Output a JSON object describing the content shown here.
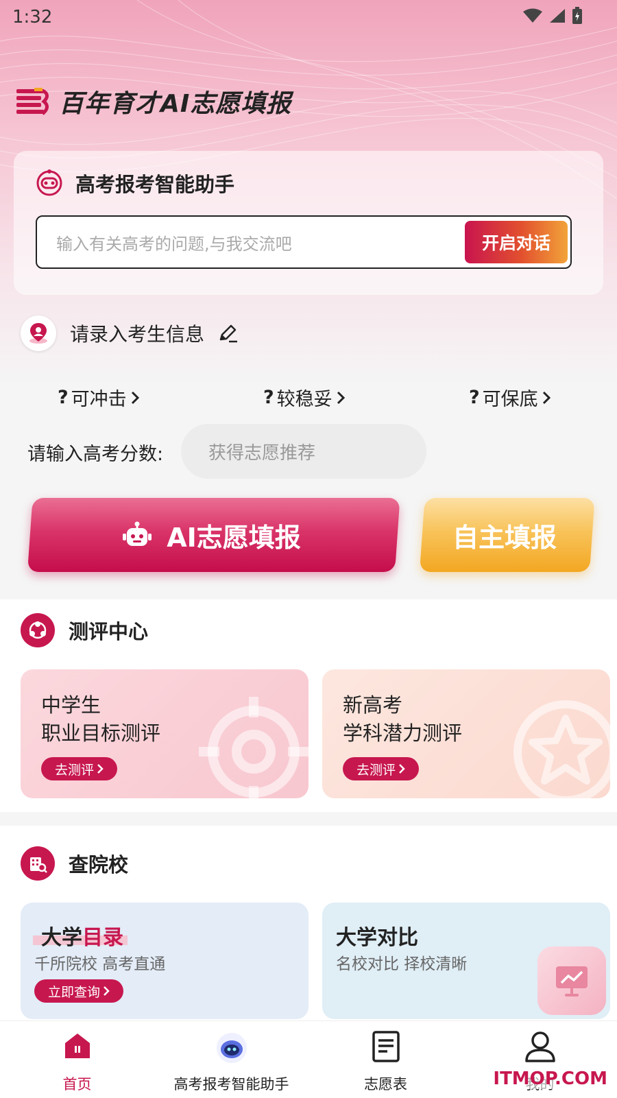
{
  "status": {
    "time": "1:32"
  },
  "app": {
    "title": "百年育才AI志愿填报"
  },
  "assistant": {
    "title": "高考报考智能助手",
    "input_placeholder": "输入有关高考的问题,与我交流吧",
    "button": "开启对话"
  },
  "student": {
    "prompt": "请录入考生信息"
  },
  "levels": [
    {
      "count": "?",
      "label": "可冲击"
    },
    {
      "count": "?",
      "label": "较稳妥"
    },
    {
      "count": "?",
      "label": "可保底"
    }
  ],
  "score": {
    "label": "请输入高考分数:",
    "placeholder": "获得志愿推荐"
  },
  "actions": {
    "ai": "AI志愿填报",
    "self": "自主填报"
  },
  "evaluation": {
    "title": "测评中心",
    "cards": [
      {
        "line1": "中学生",
        "line2": "职业目标测评",
        "button": "去测评"
      },
      {
        "line1": "新高考",
        "line2": "学科潜力测评",
        "button": "去测评"
      }
    ]
  },
  "colleges": {
    "title": "查院校",
    "cards": [
      {
        "title_a": "大学",
        "title_b": "目录",
        "subtitle": "千所院校 高考直通",
        "button": "立即查询"
      },
      {
        "title": "大学对比",
        "subtitle": "名校对比 择校清晰"
      }
    ]
  },
  "tabs": [
    {
      "label": "首页",
      "icon": "home-icon"
    },
    {
      "label": "高考报考智能助手",
      "icon": "robot-icon"
    },
    {
      "label": "志愿表",
      "icon": "document-icon"
    },
    {
      "label": "我的",
      "icon": "user-icon"
    }
  ],
  "watermark": "ITMOP.COM",
  "colors": {
    "brand": "#c7174f",
    "accent": "#f3a722"
  }
}
